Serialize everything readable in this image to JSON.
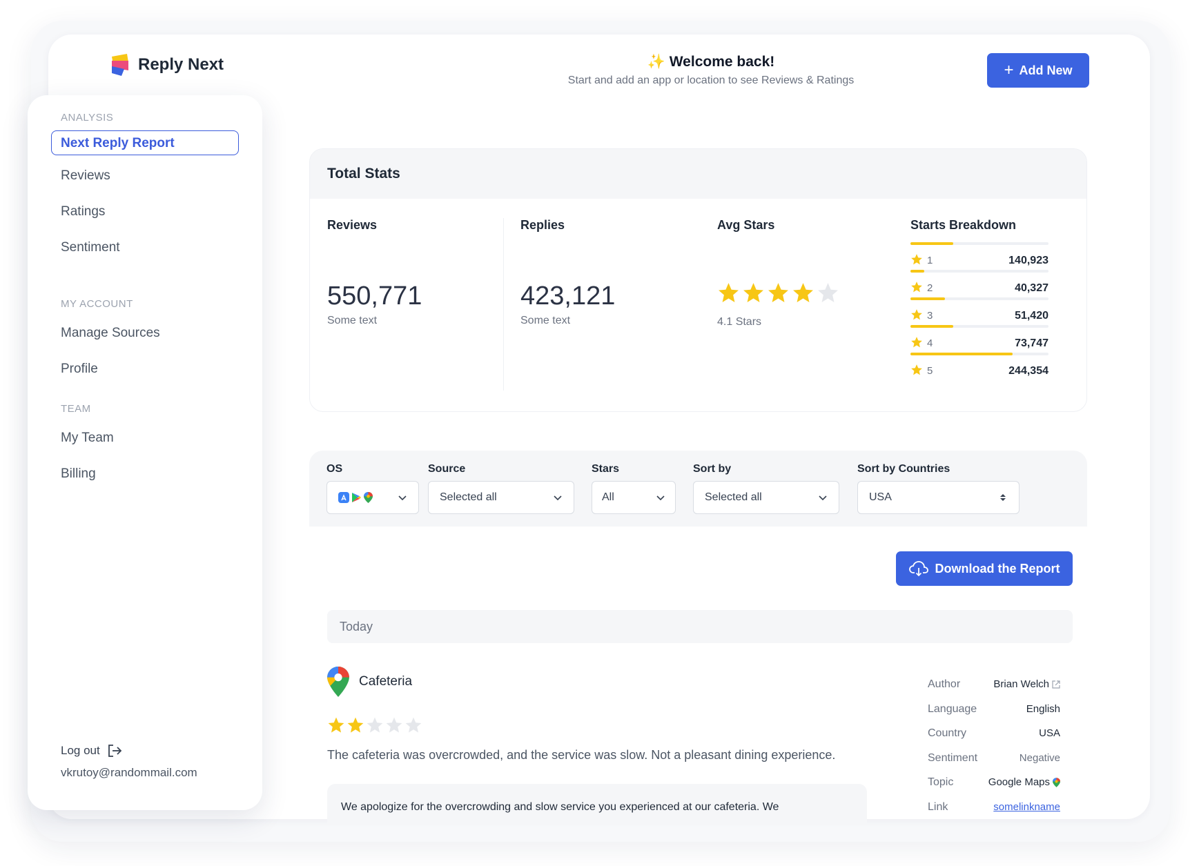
{
  "brand": {
    "name": "Reply Next"
  },
  "header": {
    "welcome_emoji": "✨",
    "welcome_title": "Welcome back!",
    "welcome_subtitle": "Start and add an app or location to see Reviews & Ratings",
    "add_button": "Add New"
  },
  "sidebar": {
    "section_analysis": "ANALYSIS",
    "items_analysis": [
      "Next Reply Report",
      "Reviews",
      "Ratings",
      "Sentiment"
    ],
    "section_account": "MY ACCOUNT",
    "items_account": [
      "Manage Sources",
      "Profile"
    ],
    "section_team": "TEAM",
    "items_team": [
      "My Team",
      "Billing"
    ],
    "logout_label": "Log out",
    "email": "vkrutoy@randommail.com"
  },
  "stats": {
    "title": "Total Stats",
    "reviews_label": "Reviews",
    "reviews_value": "550,771",
    "reviews_sub": "Some text",
    "replies_label": "Replies",
    "replies_value": "423,121",
    "replies_sub": "Some text",
    "avg_label": "Avg Stars",
    "avg_value": 4.1,
    "avg_text": "4.1 Stars",
    "breakdown_label": "Starts Breakdown",
    "breakdown": [
      {
        "star": "1",
        "count": "140,923",
        "fill": 0.31
      },
      {
        "star": "2",
        "count": "40,327",
        "fill": 0.1
      },
      {
        "star": "3",
        "count": "51,420",
        "fill": 0.25
      },
      {
        "star": "4",
        "count": "73,747",
        "fill": 0.31
      },
      {
        "star": "5",
        "count": "244,354",
        "fill": 0.74
      }
    ]
  },
  "filters": {
    "os_label": "OS",
    "source_label": "Source",
    "source_value": "Selected all",
    "stars_label": "Stars",
    "stars_value": "All",
    "sortby_label": "Sort by",
    "sortby_value": "Selected all",
    "countries_label": "Sort by Countries",
    "countries_value": "USA"
  },
  "download_button": "Download the Report",
  "feed": {
    "group_label": "Today",
    "review": {
      "place": "Cafeteria",
      "rating": 2,
      "text": "The cafeteria was overcrowded, and the service was slow. Not a pleasant dining experience.",
      "reply": "We apologize for the overcrowding and slow service you experienced at our cafeteria. We",
      "meta": {
        "author_key": "Author",
        "author_val": "Brian Welch",
        "language_key": "Language",
        "language_val": "English",
        "country_key": "Country",
        "country_val": "USA",
        "sentiment_key": "Sentiment",
        "sentiment_val": "Negative",
        "topic_key": "Topic",
        "topic_val": "Google Maps",
        "link_key": "Link",
        "link_val": "somelinkname"
      }
    }
  },
  "colors": {
    "accent": "#3b63e0",
    "star": "#f7c615",
    "star_empty": "#e5e7eb"
  }
}
